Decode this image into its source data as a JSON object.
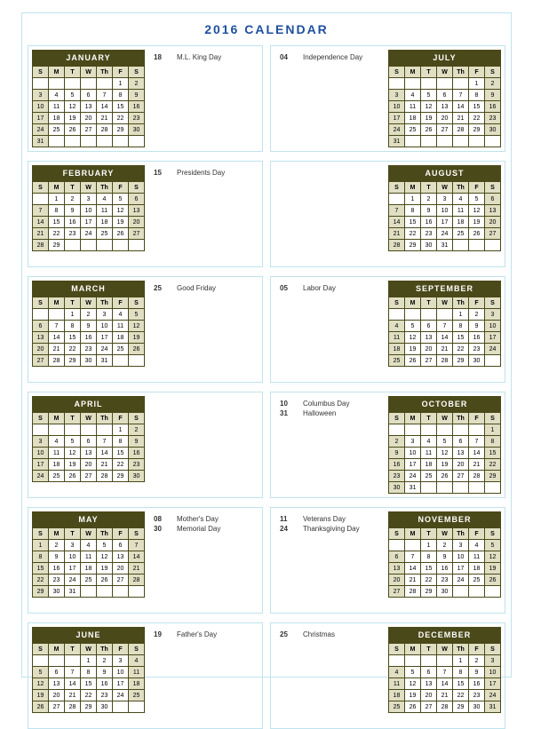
{
  "title": "2016 CALENDAR",
  "dow": [
    "S",
    "M",
    "T",
    "W",
    "Th",
    "F",
    "S"
  ],
  "months": [
    {
      "name": "JANUARY",
      "side": "left",
      "start": 5,
      "days": 31,
      "events": [
        {
          "day": "18",
          "label": "M.L. King Day"
        }
      ]
    },
    {
      "name": "JULY",
      "side": "right",
      "start": 5,
      "days": 31,
      "events": [
        {
          "day": "04",
          "label": "Independence Day"
        }
      ]
    },
    {
      "name": "FEBRUARY",
      "side": "left",
      "start": 1,
      "days": 29,
      "events": [
        {
          "day": "15",
          "label": "Presidents Day"
        }
      ]
    },
    {
      "name": "AUGUST",
      "side": "right",
      "start": 1,
      "days": 31,
      "events": []
    },
    {
      "name": "MARCH",
      "side": "left",
      "start": 2,
      "days": 31,
      "events": [
        {
          "day": "25",
          "label": "Good Friday"
        }
      ]
    },
    {
      "name": "SEPTEMBER",
      "side": "right",
      "start": 4,
      "days": 30,
      "events": [
        {
          "day": "05",
          "label": "Labor Day"
        }
      ]
    },
    {
      "name": "APRIL",
      "side": "left",
      "start": 5,
      "days": 30,
      "events": []
    },
    {
      "name": "OCTOBER",
      "side": "right",
      "start": 6,
      "days": 31,
      "events": [
        {
          "day": "10",
          "label": "Columbus Day"
        },
        {
          "day": "31",
          "label": "Halloween"
        }
      ]
    },
    {
      "name": "MAY",
      "side": "left",
      "start": 0,
      "days": 31,
      "events": [
        {
          "day": "08",
          "label": "Mother's Day"
        },
        {
          "day": "30",
          "label": "Memorial Day"
        }
      ]
    },
    {
      "name": "NOVEMBER",
      "side": "right",
      "start": 2,
      "days": 30,
      "events": [
        {
          "day": "11",
          "label": "Veterans Day"
        },
        {
          "day": "24",
          "label": "Thanksgiving Day"
        }
      ]
    },
    {
      "name": "JUNE",
      "side": "left",
      "start": 3,
      "days": 30,
      "events": [
        {
          "day": "19",
          "label": "Father's Day"
        }
      ]
    },
    {
      "name": "DECEMBER",
      "side": "right",
      "start": 4,
      "days": 31,
      "events": [
        {
          "day": "25",
          "label": "Christmas"
        }
      ]
    }
  ]
}
